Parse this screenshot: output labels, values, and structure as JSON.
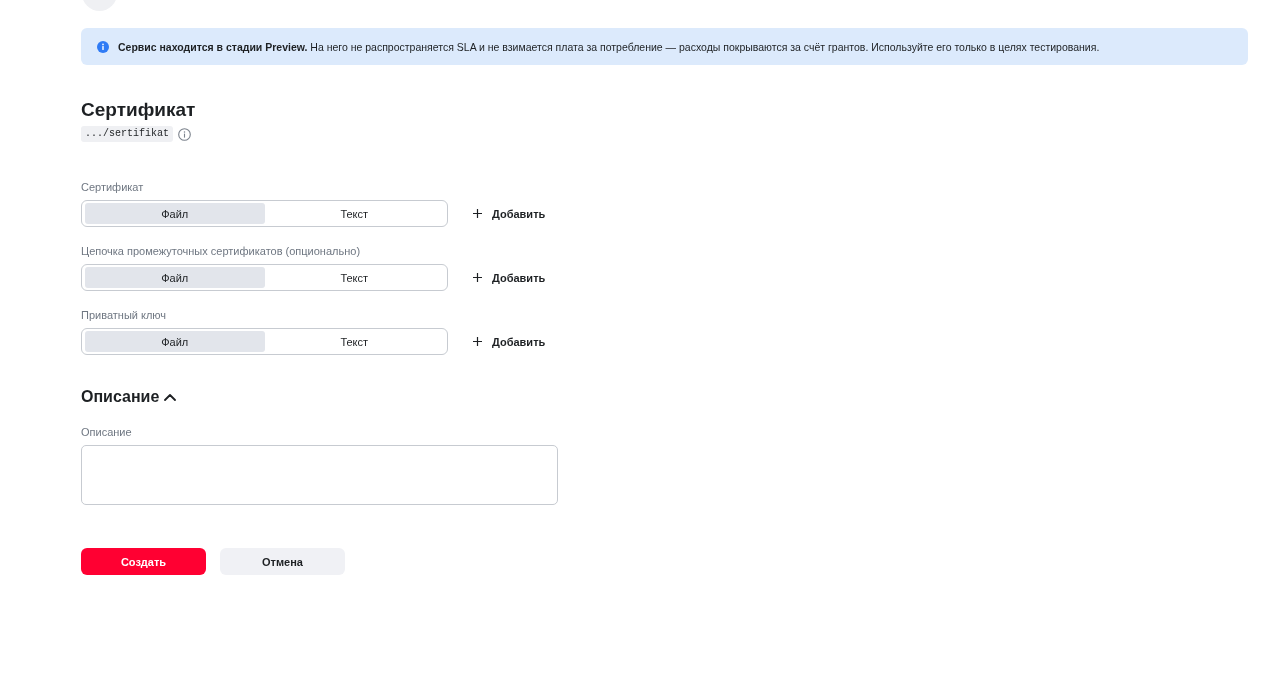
{
  "banner": {
    "text": "**Сервис находится в стадии Preview.** На него не распространяется SLA и не взимается плата за потребление — расходы покрываются за счёт грантов. Используйте его только в целях тестирования."
  },
  "page": {
    "title": "Сертификат",
    "path": ".../sertifikat"
  },
  "fields": [
    {
      "label": "Сертификат",
      "options": [
        {
          "label": "Файл",
          "selected": true
        },
        {
          "label": "Текст",
          "selected": false
        }
      ],
      "add_label": "Добавить"
    },
    {
      "label": "Цепочка промежуточных сертификатов (опционально)",
      "options": [
        {
          "label": "Файл",
          "selected": true
        },
        {
          "label": "Текст",
          "selected": false
        }
      ],
      "add_label": "Добавить"
    },
    {
      "label": "Приватный ключ",
      "options": [
        {
          "label": "Файл",
          "selected": true
        },
        {
          "label": "Текст",
          "selected": false
        }
      ],
      "add_label": "Добавить"
    }
  ],
  "description": {
    "title": "Описание",
    "expanded": true,
    "label": "Описание"
  },
  "buttons": [
    {
      "label": "Создать",
      "kind": "primary"
    },
    {
      "label": "Отмена",
      "kind": "secondary"
    }
  ]
}
